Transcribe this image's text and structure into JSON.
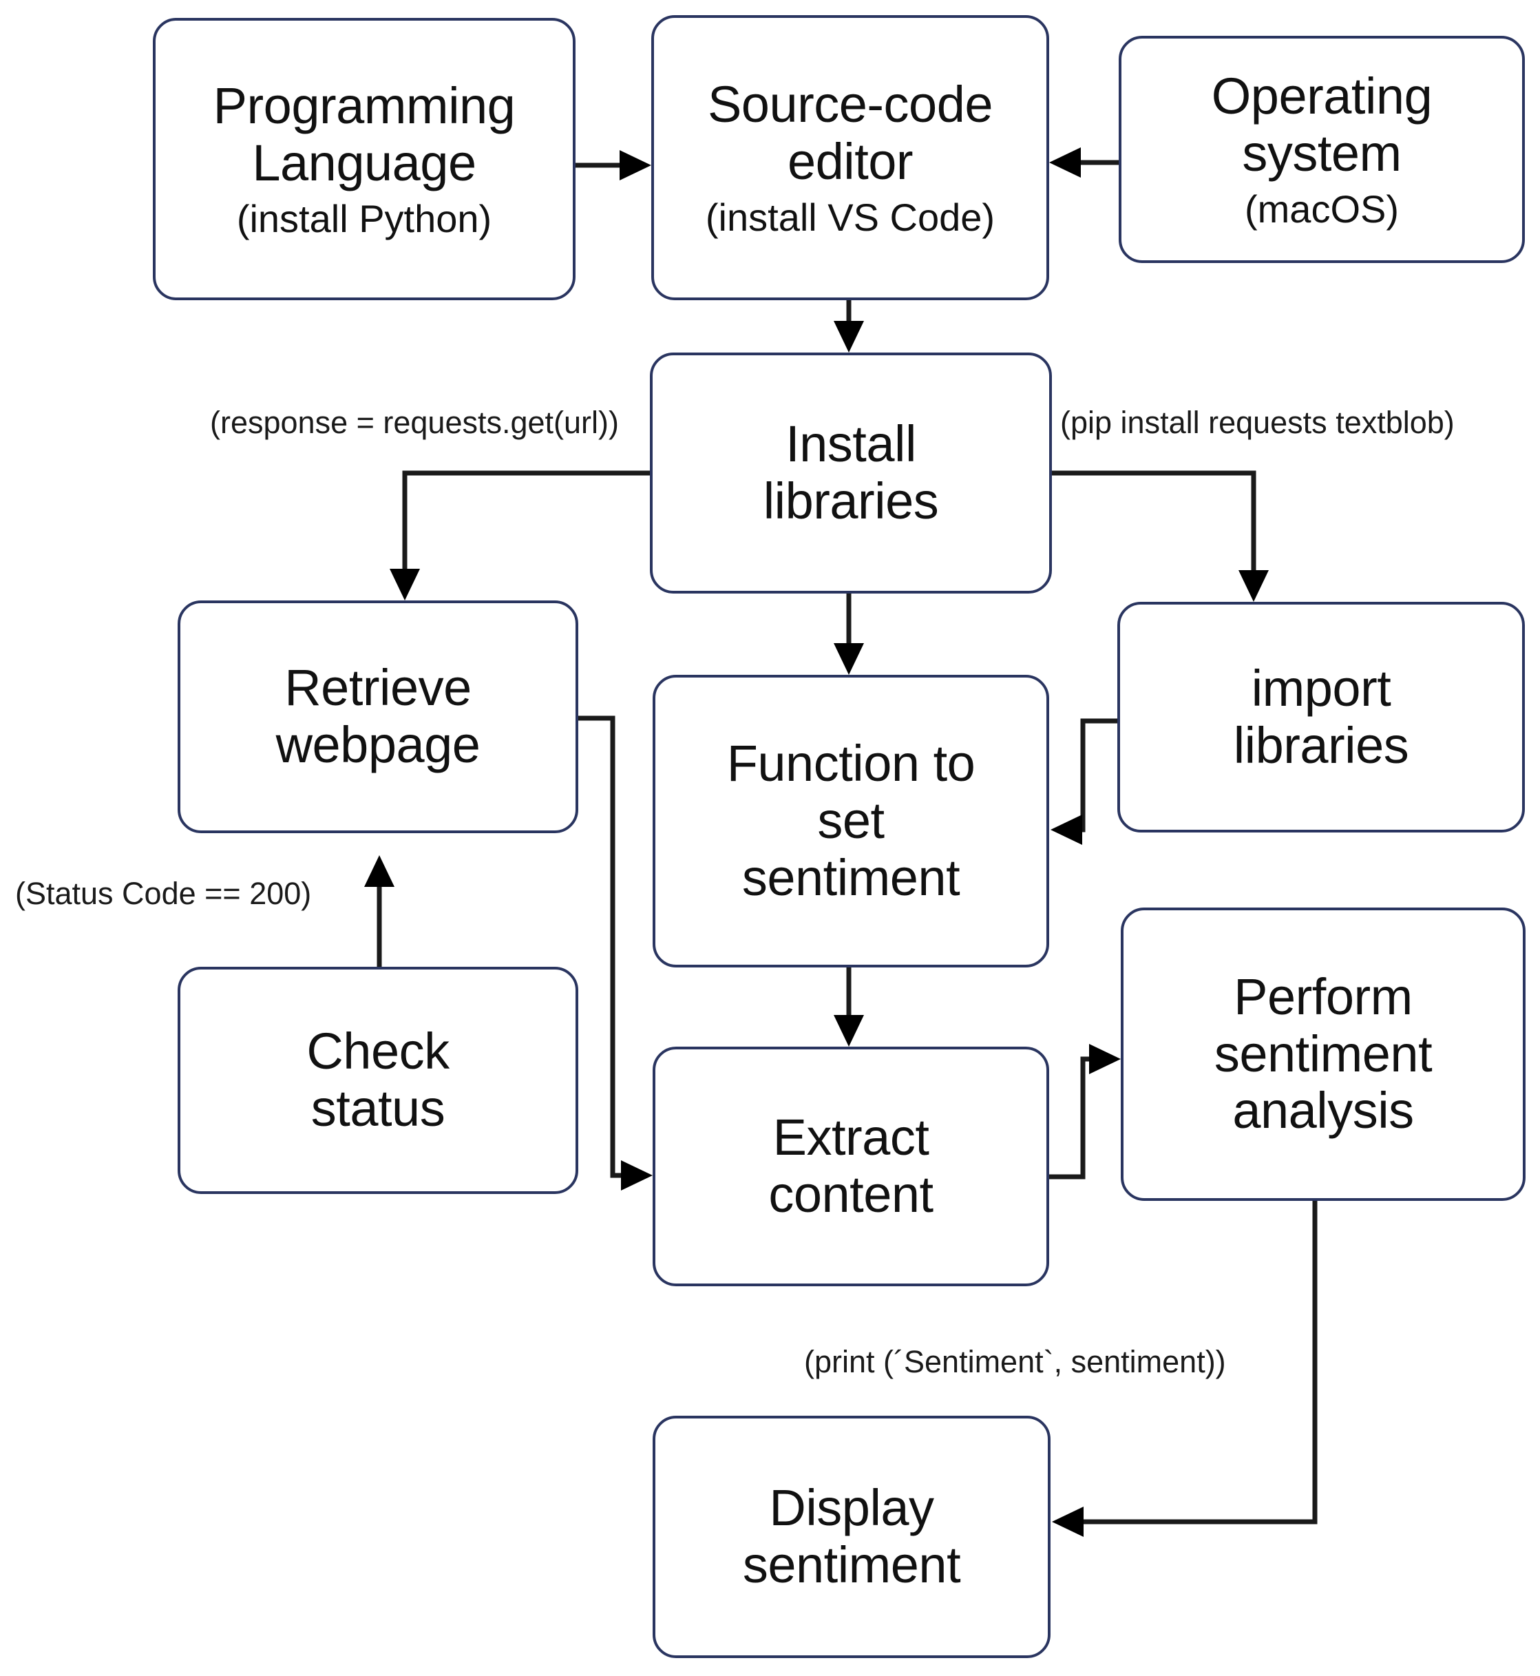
{
  "diagram": {
    "title": "Sentiment analysis setup flowchart",
    "colors": {
      "node_border": "#2a3560",
      "node_fill": "#ffffff",
      "edge_stroke": "#1a1a1a",
      "text": "#111111"
    },
    "nodes": [
      {
        "id": "programming-language",
        "main": "Programming\nLanguage",
        "sub": "(install Python)"
      },
      {
        "id": "source-code-editor",
        "main": "Source-code\neditor",
        "sub": "(install VS Code)"
      },
      {
        "id": "operating-system",
        "main": "Operating\nsystem",
        "sub": "(macOS)"
      },
      {
        "id": "install-libraries",
        "main": "Install\nlibraries",
        "sub": ""
      },
      {
        "id": "retrieve-webpage",
        "main": "Retrieve\nwebpage",
        "sub": ""
      },
      {
        "id": "function-to-set-sentiment",
        "main": "Function to\nset\nsentiment",
        "sub": ""
      },
      {
        "id": "import-libraries",
        "main": "import\nlibraries",
        "sub": ""
      },
      {
        "id": "check-status",
        "main": "Check\nstatus",
        "sub": ""
      },
      {
        "id": "extract-content",
        "main": "Extract\ncontent",
        "sub": ""
      },
      {
        "id": "perform-sentiment-analysis",
        "main": "Perform\nsentiment\nanalysis",
        "sub": ""
      },
      {
        "id": "display-sentiment",
        "main": "Display\nsentiment",
        "sub": ""
      }
    ],
    "edge_labels": [
      {
        "id": "response-get-url",
        "text": "(response = requests.get(url))"
      },
      {
        "id": "pip-install",
        "text": "(pip install requests textblob)"
      },
      {
        "id": "status-code-200",
        "text": "(Status Code == 200)"
      },
      {
        "id": "print-sentiment",
        "text": "(print (´Sentiment`, sentiment))"
      }
    ],
    "edges": [
      {
        "from": "programming-language",
        "to": "source-code-editor"
      },
      {
        "from": "operating-system",
        "to": "source-code-editor"
      },
      {
        "from": "source-code-editor",
        "to": "install-libraries"
      },
      {
        "from": "install-libraries",
        "to": "retrieve-webpage",
        "label": "(response = requests.get(url))"
      },
      {
        "from": "install-libraries",
        "to": "import-libraries",
        "label": "(pip install requests textblob)"
      },
      {
        "from": "install-libraries",
        "to": "function-to-set-sentiment"
      },
      {
        "from": "import-libraries",
        "to": "function-to-set-sentiment"
      },
      {
        "from": "check-status",
        "to": "retrieve-webpage",
        "label": "(Status Code == 200)"
      },
      {
        "from": "retrieve-webpage",
        "to": "extract-content"
      },
      {
        "from": "function-to-set-sentiment",
        "to": "extract-content"
      },
      {
        "from": "extract-content",
        "to": "perform-sentiment-analysis"
      },
      {
        "from": "perform-sentiment-analysis",
        "to": "display-sentiment",
        "label": "(print (´Sentiment`, sentiment))"
      }
    ]
  }
}
